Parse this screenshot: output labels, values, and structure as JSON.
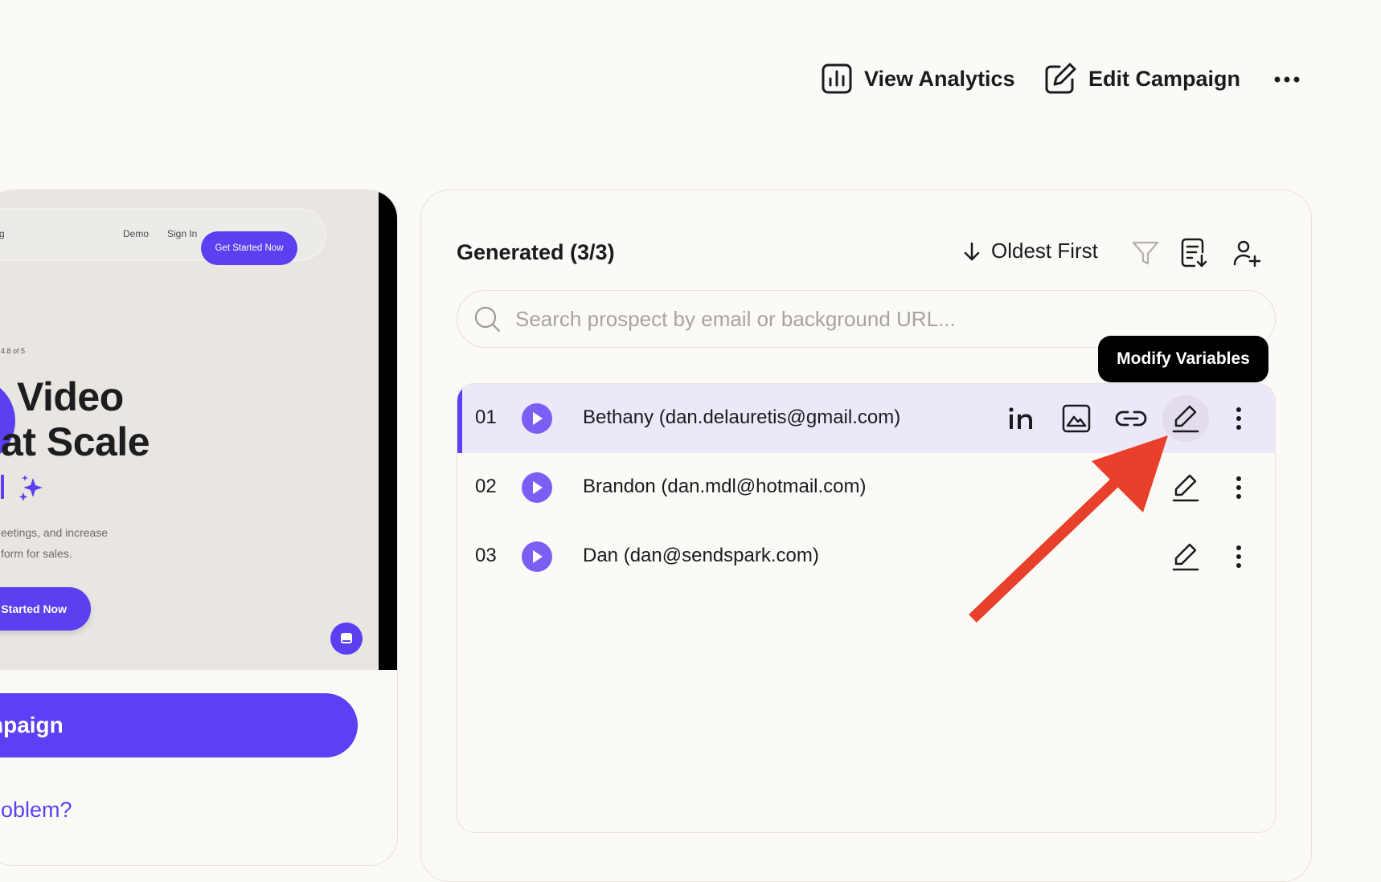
{
  "header": {
    "analytics_label": "View Analytics",
    "edit_label": "Edit Campaign",
    "more_icon": "more-horizontal-icon"
  },
  "preview": {
    "nav_links": [
      "icing",
      "Demo",
      "Sign In"
    ],
    "nav_cta": "Get Started Now",
    "rating": "4.8 of 5",
    "headline_1": "Video",
    "headline_2": "at Scale",
    "body_1": "eetings, and increase",
    "body_2": "form for sales.",
    "cta": "t Started Now"
  },
  "left": {
    "campaign_button": "npaign",
    "problem_link": "oblem?"
  },
  "panel": {
    "title": "Generated (3/3)",
    "sort_label": "Oldest First",
    "search_placeholder": "Search prospect by email or background URL...",
    "tooltip": "Modify Variables"
  },
  "prospects": [
    {
      "num": "01",
      "name": "Bethany (dan.delauretis@gmail.com)"
    },
    {
      "num": "02",
      "name": "Brandon (dan.mdl@hotmail.com)"
    },
    {
      "num": "03",
      "name": "Dan (dan@sendspark.com)"
    }
  ],
  "colors": {
    "accent": "#5d3ff4",
    "active_row": "#ede8f7",
    "background": "#fcfaf6",
    "annotation_arrow": "#e8402a"
  }
}
